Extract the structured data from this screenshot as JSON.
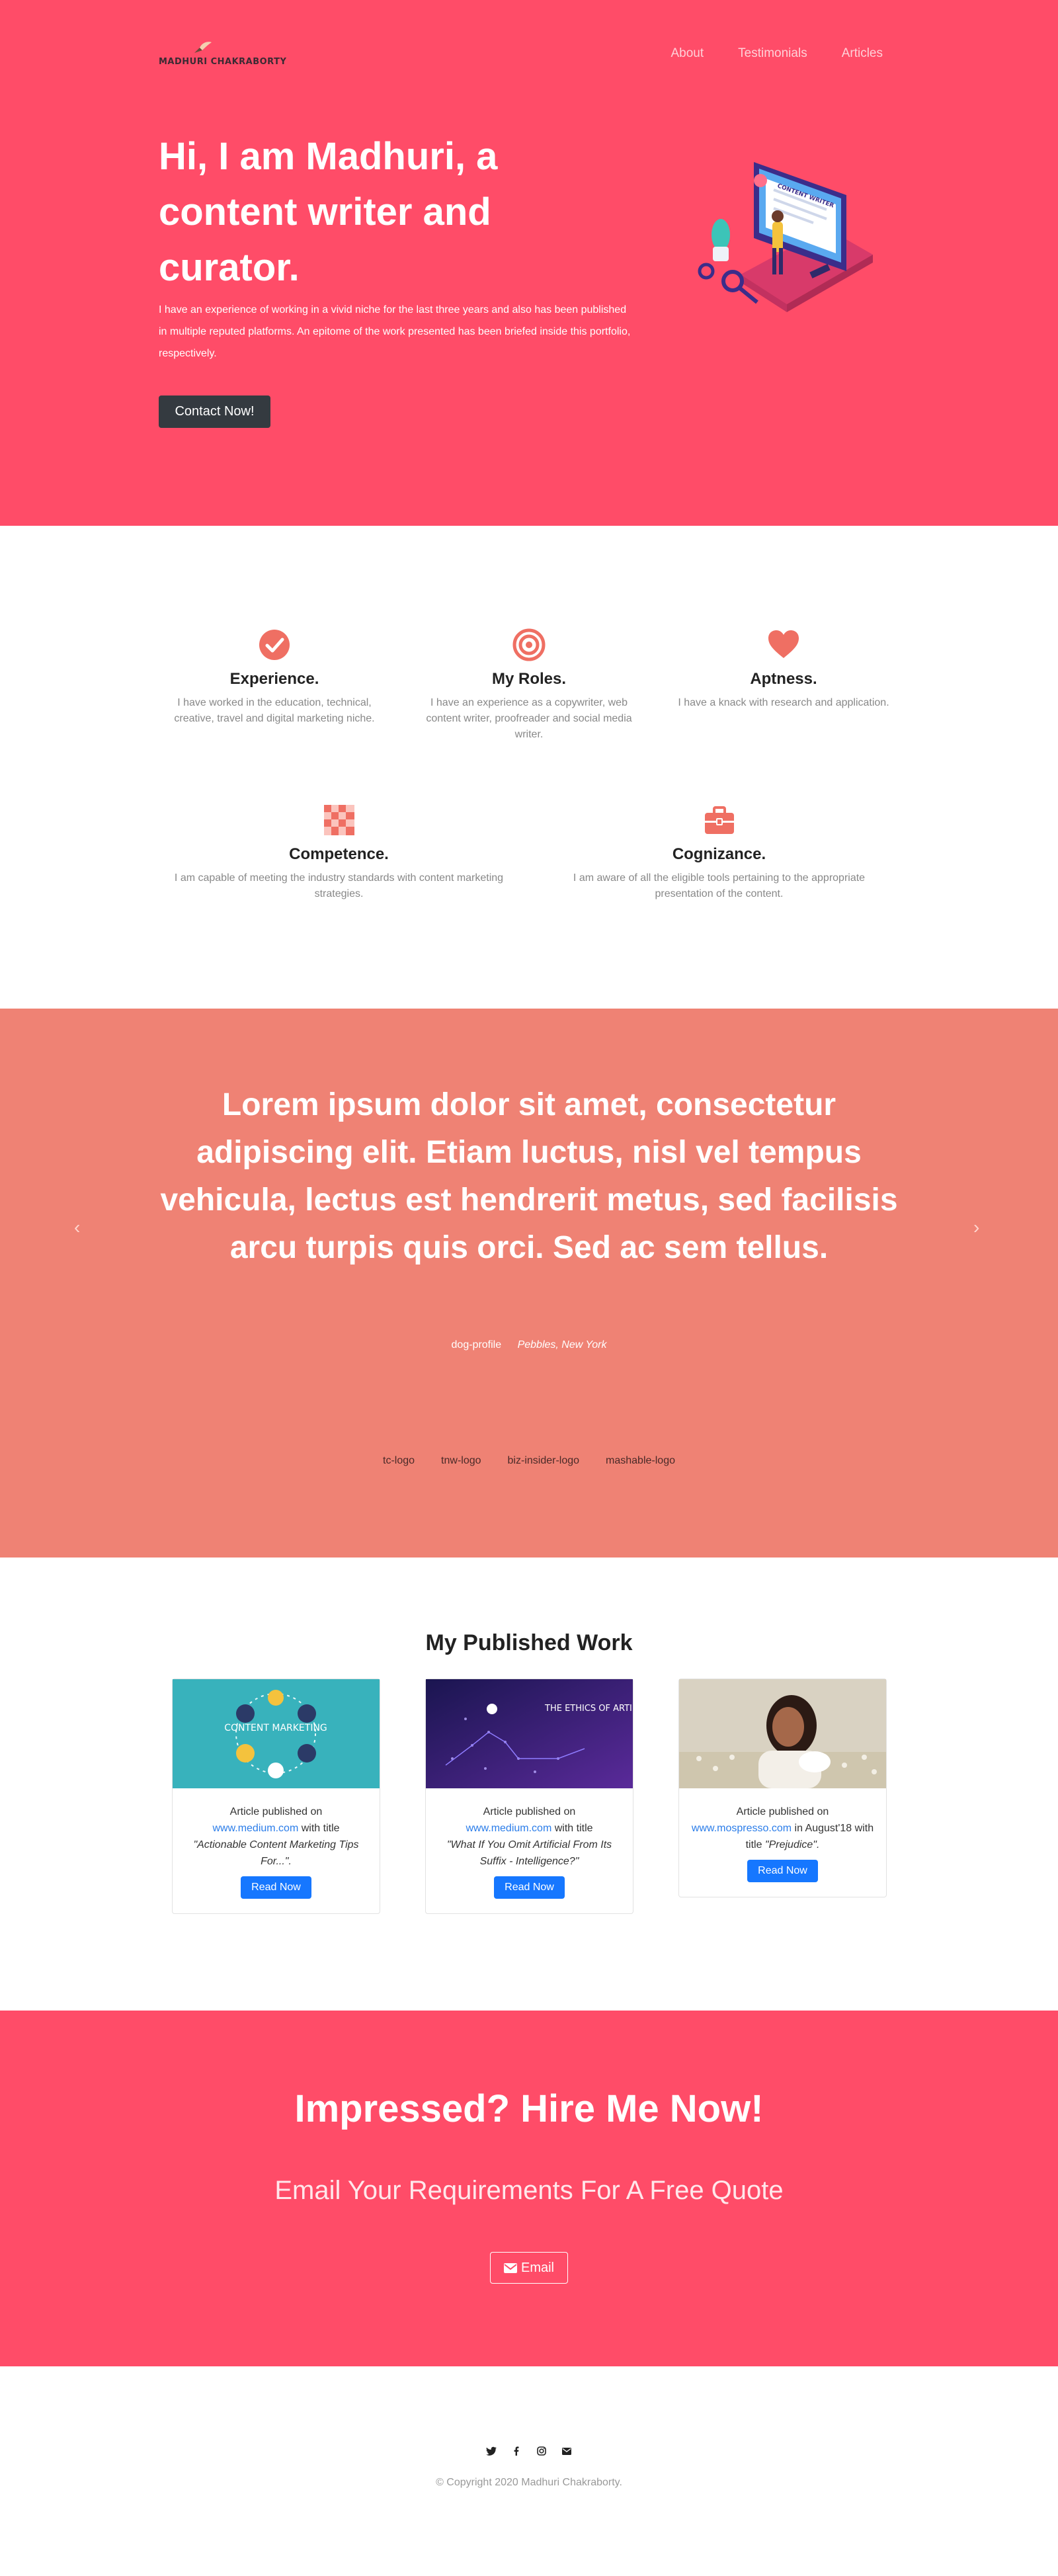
{
  "colors": {
    "hero_bg": "#ff4c68",
    "accent_icon": "#ef6f63",
    "testimonial_bg": "#ef8274",
    "button_dark": "#343a40",
    "button_blue": "#1677ff",
    "link": "#2b7de9"
  },
  "header": {
    "logo_text": "MADHURI CHAKRABORTY",
    "nav": [
      "About",
      "Testimonials",
      "Articles"
    ]
  },
  "hero": {
    "title": "Hi, I am Madhuri, a content writer and curator.",
    "description": "I have an experience of working in a vivid niche for the last three years and also has been published in multiple reputed platforms. An epitome of the work presented has been briefed inside this portfolio, respectively.",
    "cta": "Contact Now!",
    "illustration_caption": "CONTENT WRITER"
  },
  "features": [
    {
      "icon": "check-circle-icon",
      "title": "Experience.",
      "desc": "I have worked in the education, technical, creative, travel and digital marketing niche."
    },
    {
      "icon": "target-icon",
      "title": "My Roles.",
      "desc": "I have an experience as a copywriter, web content writer, proofreader and social media writer."
    },
    {
      "icon": "heart-icon",
      "title": "Aptness.",
      "desc": "I have a knack with research and application."
    },
    {
      "icon": "chess-board-icon",
      "title": "Competence.",
      "desc": "I am capable of meeting the industry standards with content marketing strategies."
    },
    {
      "icon": "toolbox-icon",
      "title": "Cognizance.",
      "desc": "I am aware of all the eligible tools pertaining to the appropriate presentation of the content."
    }
  ],
  "testimonial": {
    "quote": "Lorem ipsum dolor sit amet, consectetur adipiscing elit. Etiam luctus, nisl vel tempus vehicula, lectus est hendrerit metus, sed facilisis arcu turpis quis orci. Sed ac sem tellus.",
    "photo_alt": "dog-profile",
    "name": "Pebbles, New York",
    "prev_icon": "chevron-left-icon",
    "next_icon": "chevron-right-icon",
    "press_logos": [
      "tc-logo",
      "tnw-logo",
      "biz-insider-logo",
      "mashable-logo"
    ]
  },
  "published": {
    "heading": "My Published Work",
    "cards": [
      {
        "prefix": "Article published on",
        "link": "www.medium.com",
        "mid": "with title",
        "title": "\"Actionable Content Marketing Tips For...\".",
        "button": "Read Now",
        "image_text": "CONTENT MARKETING"
      },
      {
        "prefix": "Article published on",
        "link": "www.medium.com",
        "mid": "with title",
        "title": "\"What If You Omit Artificial From Its Suffix - Intelligence?\"",
        "button": "Read Now",
        "image_text": "THE ETHICS OF ARTIFICIAL INTELLIGENCE"
      },
      {
        "prefix": "Article published on",
        "link": "www.mospresso.com",
        "mid": "in August'18 with title",
        "title": "\"Prejudice\".",
        "button": "Read Now"
      }
    ]
  },
  "hire": {
    "title": "Impressed? Hire Me Now!",
    "subtitle": "Email Your Requirements For A Free Quote",
    "button": "Email"
  },
  "footer": {
    "social": [
      "twitter-icon",
      "facebook-icon",
      "instagram-icon",
      "envelope-icon"
    ],
    "copyright": "© Copyright 2020 Madhuri Chakraborty."
  }
}
